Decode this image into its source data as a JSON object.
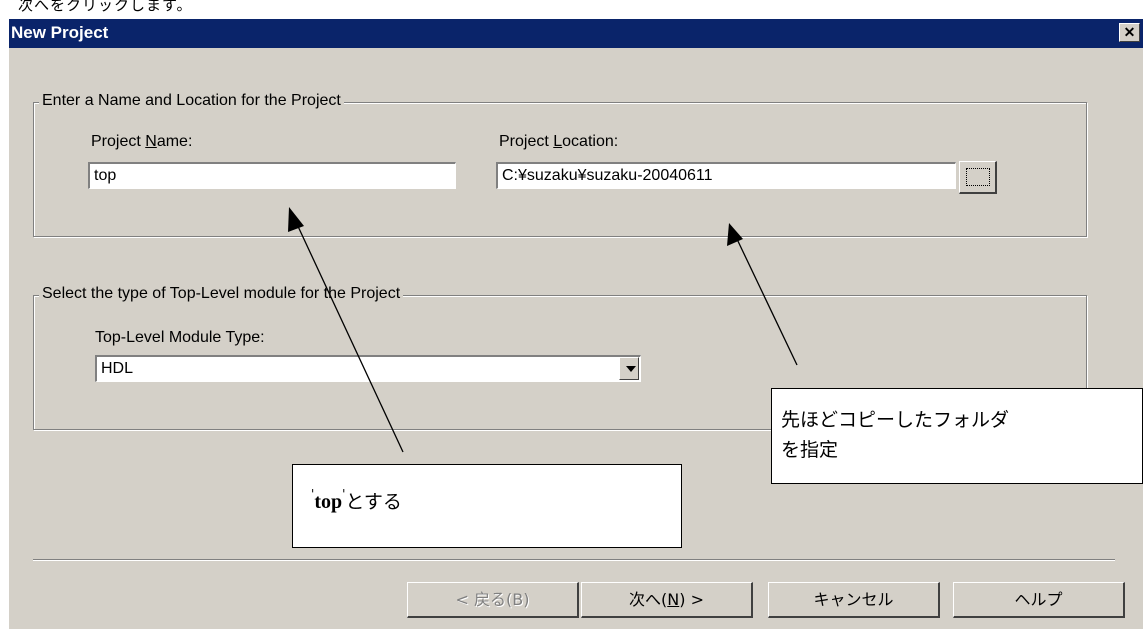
{
  "caption_top": "次へをクリックします。",
  "window": {
    "title": "New Project",
    "close_label": "✕"
  },
  "group1": {
    "legend": "Enter a Name and Location for the Project",
    "name_label_pre": "Project ",
    "name_label_key": "N",
    "name_label_post": "ame:",
    "name_value": "top",
    "location_label_pre": "Project ",
    "location_label_key": "L",
    "location_label_post": "ocation:",
    "location_value": "C:¥suzaku¥suzaku-20040611"
  },
  "group2": {
    "legend": "Select the type of Top-Level module for the Project",
    "type_label": "Top-Level Module Type:",
    "type_value": "HDL"
  },
  "buttons": {
    "back": "< 戻る(B)",
    "next_pre": "次へ(",
    "next_key": "N",
    "next_post": ") >",
    "cancel": "キャンセル",
    "help": "ヘルプ"
  },
  "callouts": {
    "name_note_quote_open": "'",
    "name_note_bold": "top",
    "name_note_quote_close": "'",
    "name_note_rest": "とする",
    "location_note_line1": "先ほどコピーしたフォルダ",
    "location_note_line2": "を指定"
  }
}
